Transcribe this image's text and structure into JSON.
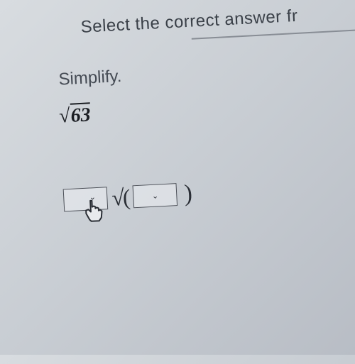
{
  "question": {
    "instruction": "Select the correct answer fr",
    "prompt": "Simplify.",
    "expression_radical": "√",
    "expression_radicand": "63"
  },
  "answer_template": {
    "sqrt_open": "√(",
    "close_paren": ")",
    "dropdown1_value": "",
    "dropdown2_value": ""
  },
  "icons": {
    "chevron_down": "⌄"
  }
}
